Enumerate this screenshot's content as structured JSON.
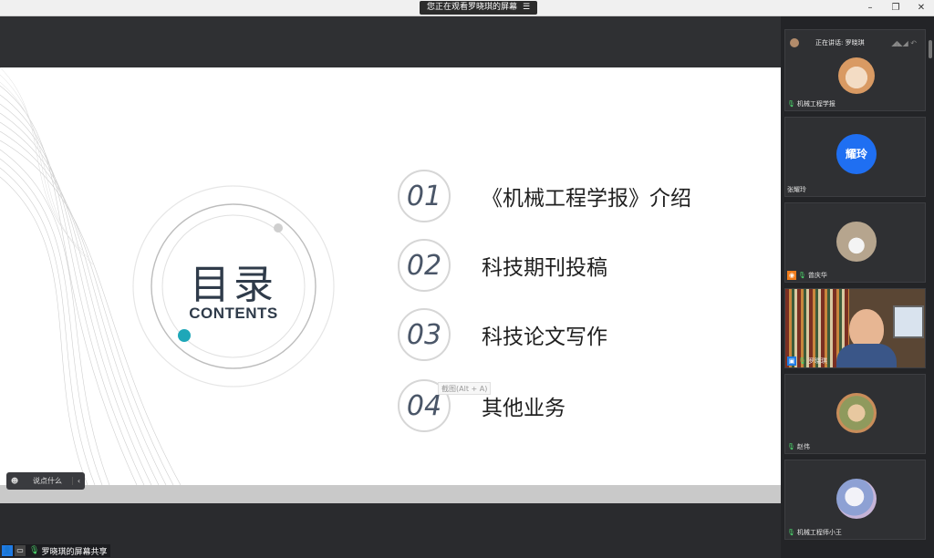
{
  "window": {
    "share_tag": "您正在观看罗晓琪的屏幕",
    "menu_icon": "☰",
    "min_icon": "–",
    "restore_icon": "❐",
    "close_icon": "✕"
  },
  "slide": {
    "title": "目录",
    "subtitle": "CONTENTS",
    "items": [
      {
        "num": "01",
        "text": "《机械工程学报》介绍"
      },
      {
        "num": "02",
        "text": "科技期刊投稿"
      },
      {
        "num": "03",
        "text": "科技论文写作"
      },
      {
        "num": "04",
        "text": "其他业务"
      }
    ],
    "tooltip": "截图(Alt + A)",
    "accent_color": "#1ea7b8"
  },
  "speaker_button": {
    "icon": "☻",
    "label": "说点什么",
    "chevron": "‹"
  },
  "panel": {
    "speaking_label": "正在讲话: 罗晓琪",
    "tiles": [
      {
        "name": "机械工程学报"
      },
      {
        "name": "张耀玲",
        "avatar_text": "耀玲"
      },
      {
        "name": "曾庆华"
      },
      {
        "name": "罗晓琪"
      },
      {
        "name": "赵伟"
      },
      {
        "name": "机械工程师小王"
      }
    ]
  },
  "statusbar": {
    "share_label": "罗晓琪的屏幕共享"
  }
}
